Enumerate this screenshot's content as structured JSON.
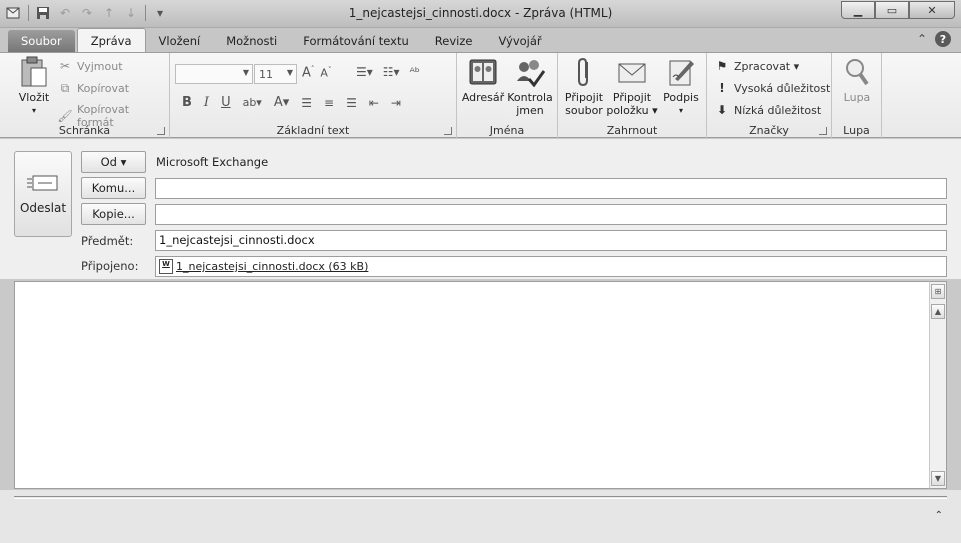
{
  "window": {
    "title": "1_nejcastejsi_cinnosti.docx  -  Zpráva (HTML)",
    "minimize_glyph": "▁",
    "maximize_glyph": "▭",
    "close_glyph": "✕"
  },
  "quick_access": {
    "items": [
      "app-icon",
      "save-icon",
      "undo-icon",
      "redo-icon",
      "up-arrow-icon",
      "down-arrow-icon",
      "customize-icon"
    ]
  },
  "tabs": [
    {
      "label": "Soubor",
      "type": "file"
    },
    {
      "label": "Zpráva",
      "type": "active"
    },
    {
      "label": "Vložení"
    },
    {
      "label": "Možnosti"
    },
    {
      "label": "Formátování textu"
    },
    {
      "label": "Revize"
    },
    {
      "label": "Vývojář"
    }
  ],
  "ribbon": {
    "clipboard": {
      "label": "Schránka",
      "paste": "Vložit",
      "cut": "Vyjmout",
      "copy": "Kopírovat",
      "format_painter": "Kopírovat formát"
    },
    "basic_text": {
      "label": "Základní text",
      "font_name": "",
      "font_size": "11",
      "bold": "B",
      "italic": "I",
      "underline": "U"
    },
    "names": {
      "label": "Jména",
      "address_book": "Adresář",
      "check_names_1": "Kontrola",
      "check_names_2": "jmen"
    },
    "include": {
      "label": "Zahrnout",
      "attach_file_1": "Připojit",
      "attach_file_2": "soubor",
      "attach_item_1": "Připojit",
      "attach_item_2": "položku ▾",
      "signature": "Podpis"
    },
    "tags": {
      "label": "Značky",
      "follow_up": "Zpracovat ▾",
      "high_importance": "Vysoká důležitost",
      "low_importance": "Nízká důležitost"
    },
    "zoom": {
      "label": "Lupa",
      "zoom": "Lupa"
    }
  },
  "header": {
    "send": "Odeslat",
    "from_button": "Od ▾",
    "from_value": "Microsoft Exchange",
    "to_button": "Komu...",
    "to_value": "",
    "cc_button": "Kopie...",
    "cc_value": "",
    "subject_label": "Předmět:",
    "subject_value": "1_nejcastejsi_cinnosti.docx",
    "attached_label": "Připojeno:",
    "attachment": "1_nejcastejsi_cinnosti.docx (63 kB)"
  },
  "body": {
    "text": ""
  }
}
